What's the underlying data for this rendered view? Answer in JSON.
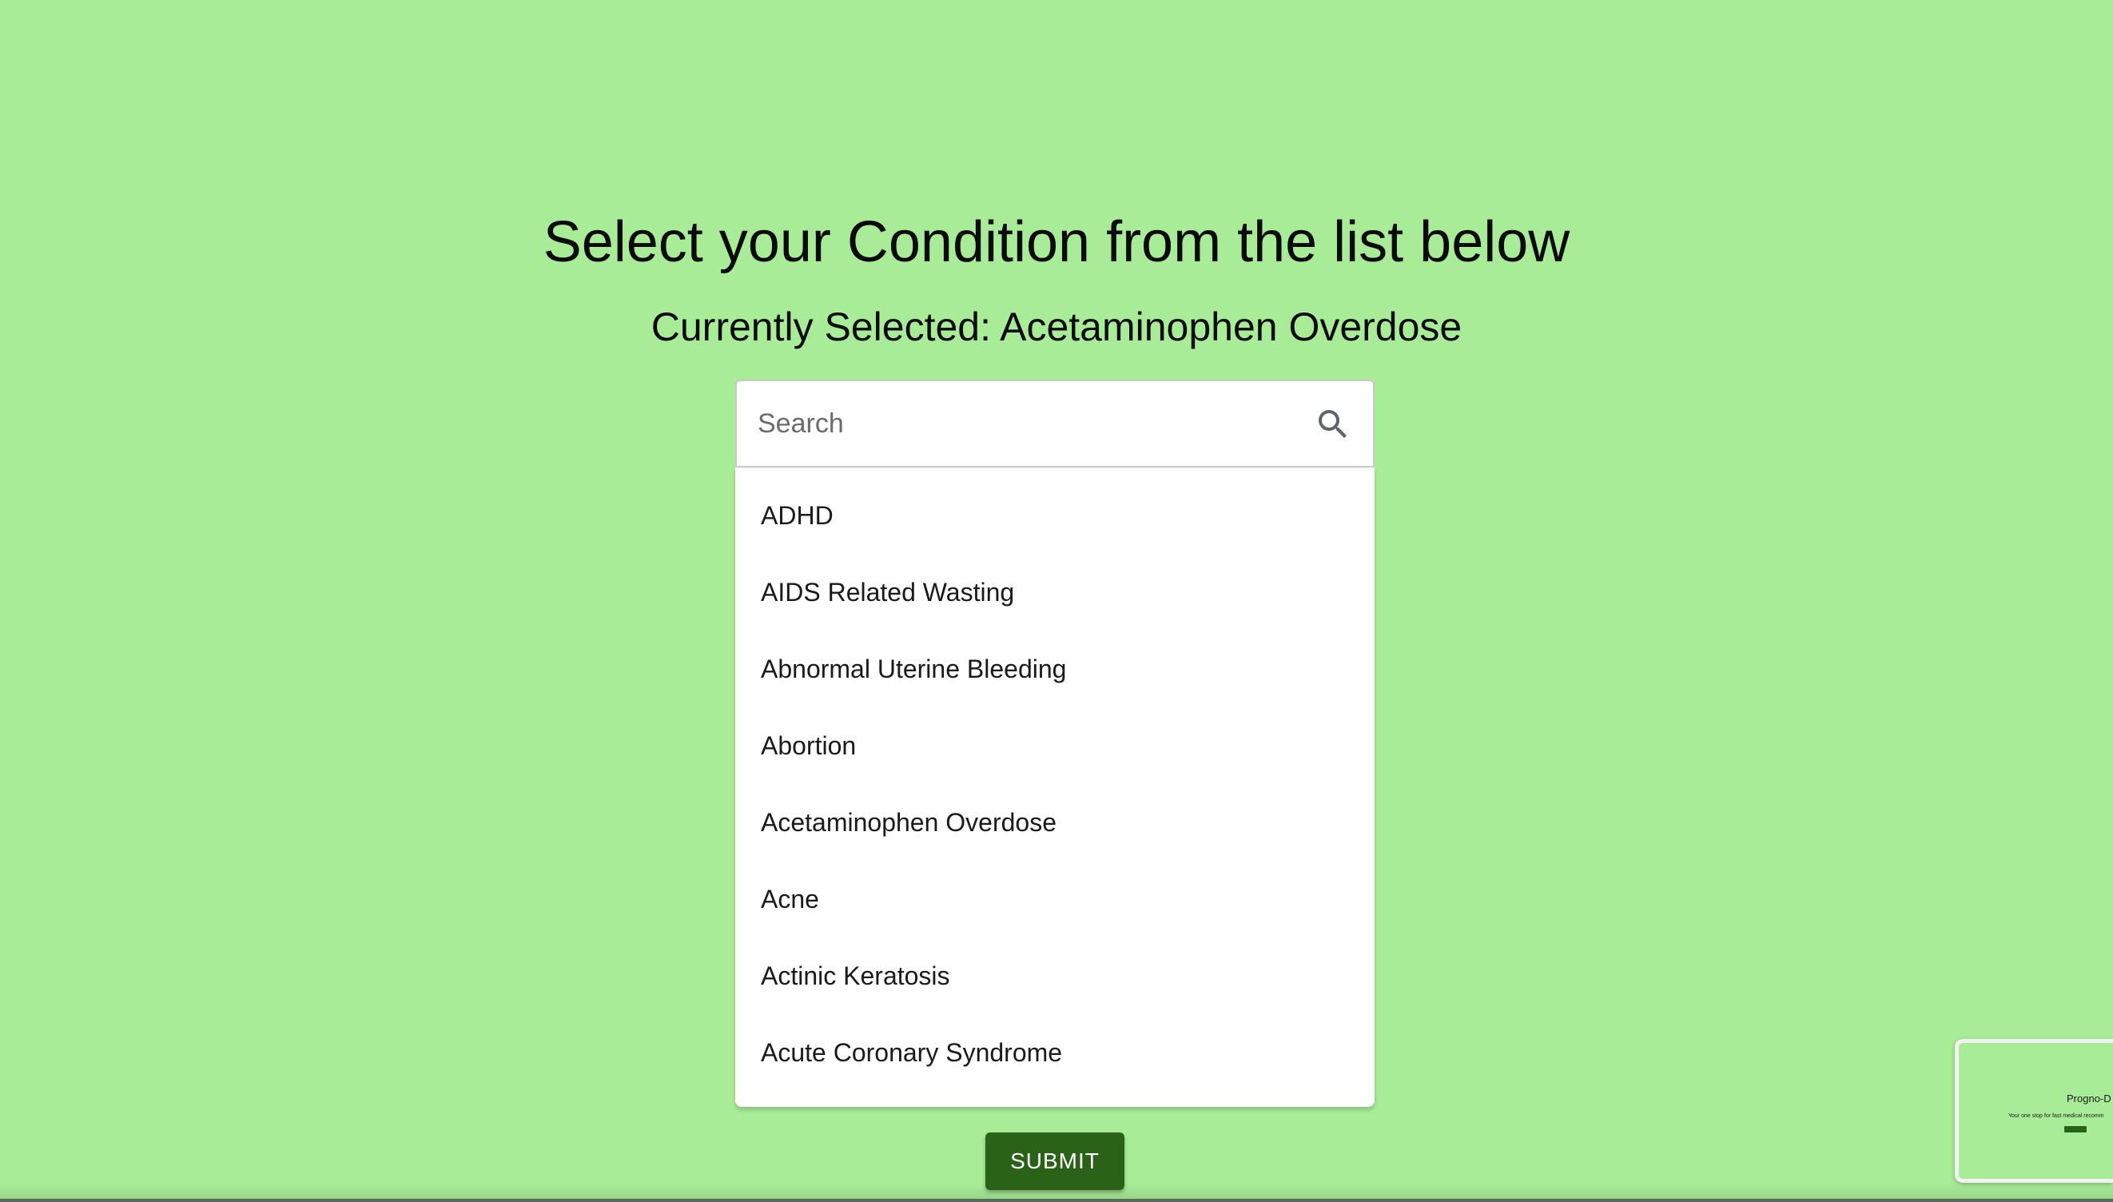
{
  "page": {
    "title": "Select your Condition from the list below",
    "currently_selected_label": "Currently Selected:",
    "currently_selected_value": "Acetaminophen Overdose"
  },
  "search": {
    "placeholder": "Search",
    "value": "",
    "icon": "search-icon"
  },
  "conditions": [
    "ADHD",
    "AIDS Related Wasting",
    "Abnormal Uterine Bleeding",
    "Abortion",
    "Acetaminophen Overdose",
    "Acne",
    "Actinic Keratosis",
    "Acute Coronary Syndrome"
  ],
  "submit_label": "SUBMIT",
  "thumbnail": {
    "title": "Progno-D",
    "subtitle": "Your one stop for fast medical recomm"
  },
  "colors": {
    "background": "#a8ec98",
    "button": "#2a6318",
    "panel": "#ffffff"
  }
}
